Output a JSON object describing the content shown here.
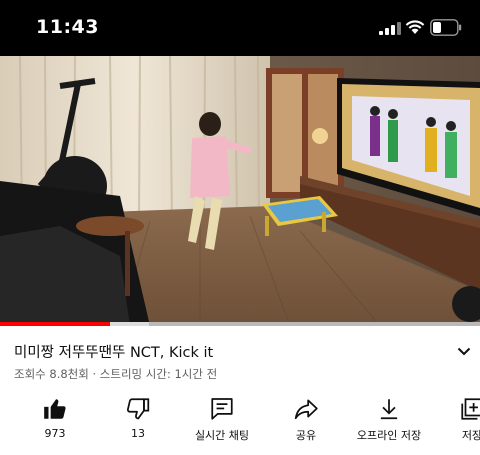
{
  "status_bar": {
    "time": "11:43",
    "icons": [
      "cellular-signal-icon",
      "wifi-icon",
      "battery-icon"
    ]
  },
  "video": {
    "progress_fraction": 0.23,
    "buffered_fraction": 0.31,
    "progress_color": "#ff0000"
  },
  "title": {
    "text": "미미짱 저뚜뚜땐뚜 NCT, Kick it",
    "meta": "조회수 8.8천회 · 스트리밍 시간: 1시간 전"
  },
  "actions": [
    {
      "icon": "thumbs-up-icon",
      "label": "973"
    },
    {
      "icon": "thumbs-down-icon",
      "label": "13"
    },
    {
      "icon": "live-chat-icon",
      "label": "실시간 채팅"
    },
    {
      "icon": "share-icon",
      "label": "공유"
    },
    {
      "icon": "download-icon",
      "label": "오프라인 저장"
    },
    {
      "icon": "save-to-playlist-icon",
      "label": "저장"
    }
  ]
}
